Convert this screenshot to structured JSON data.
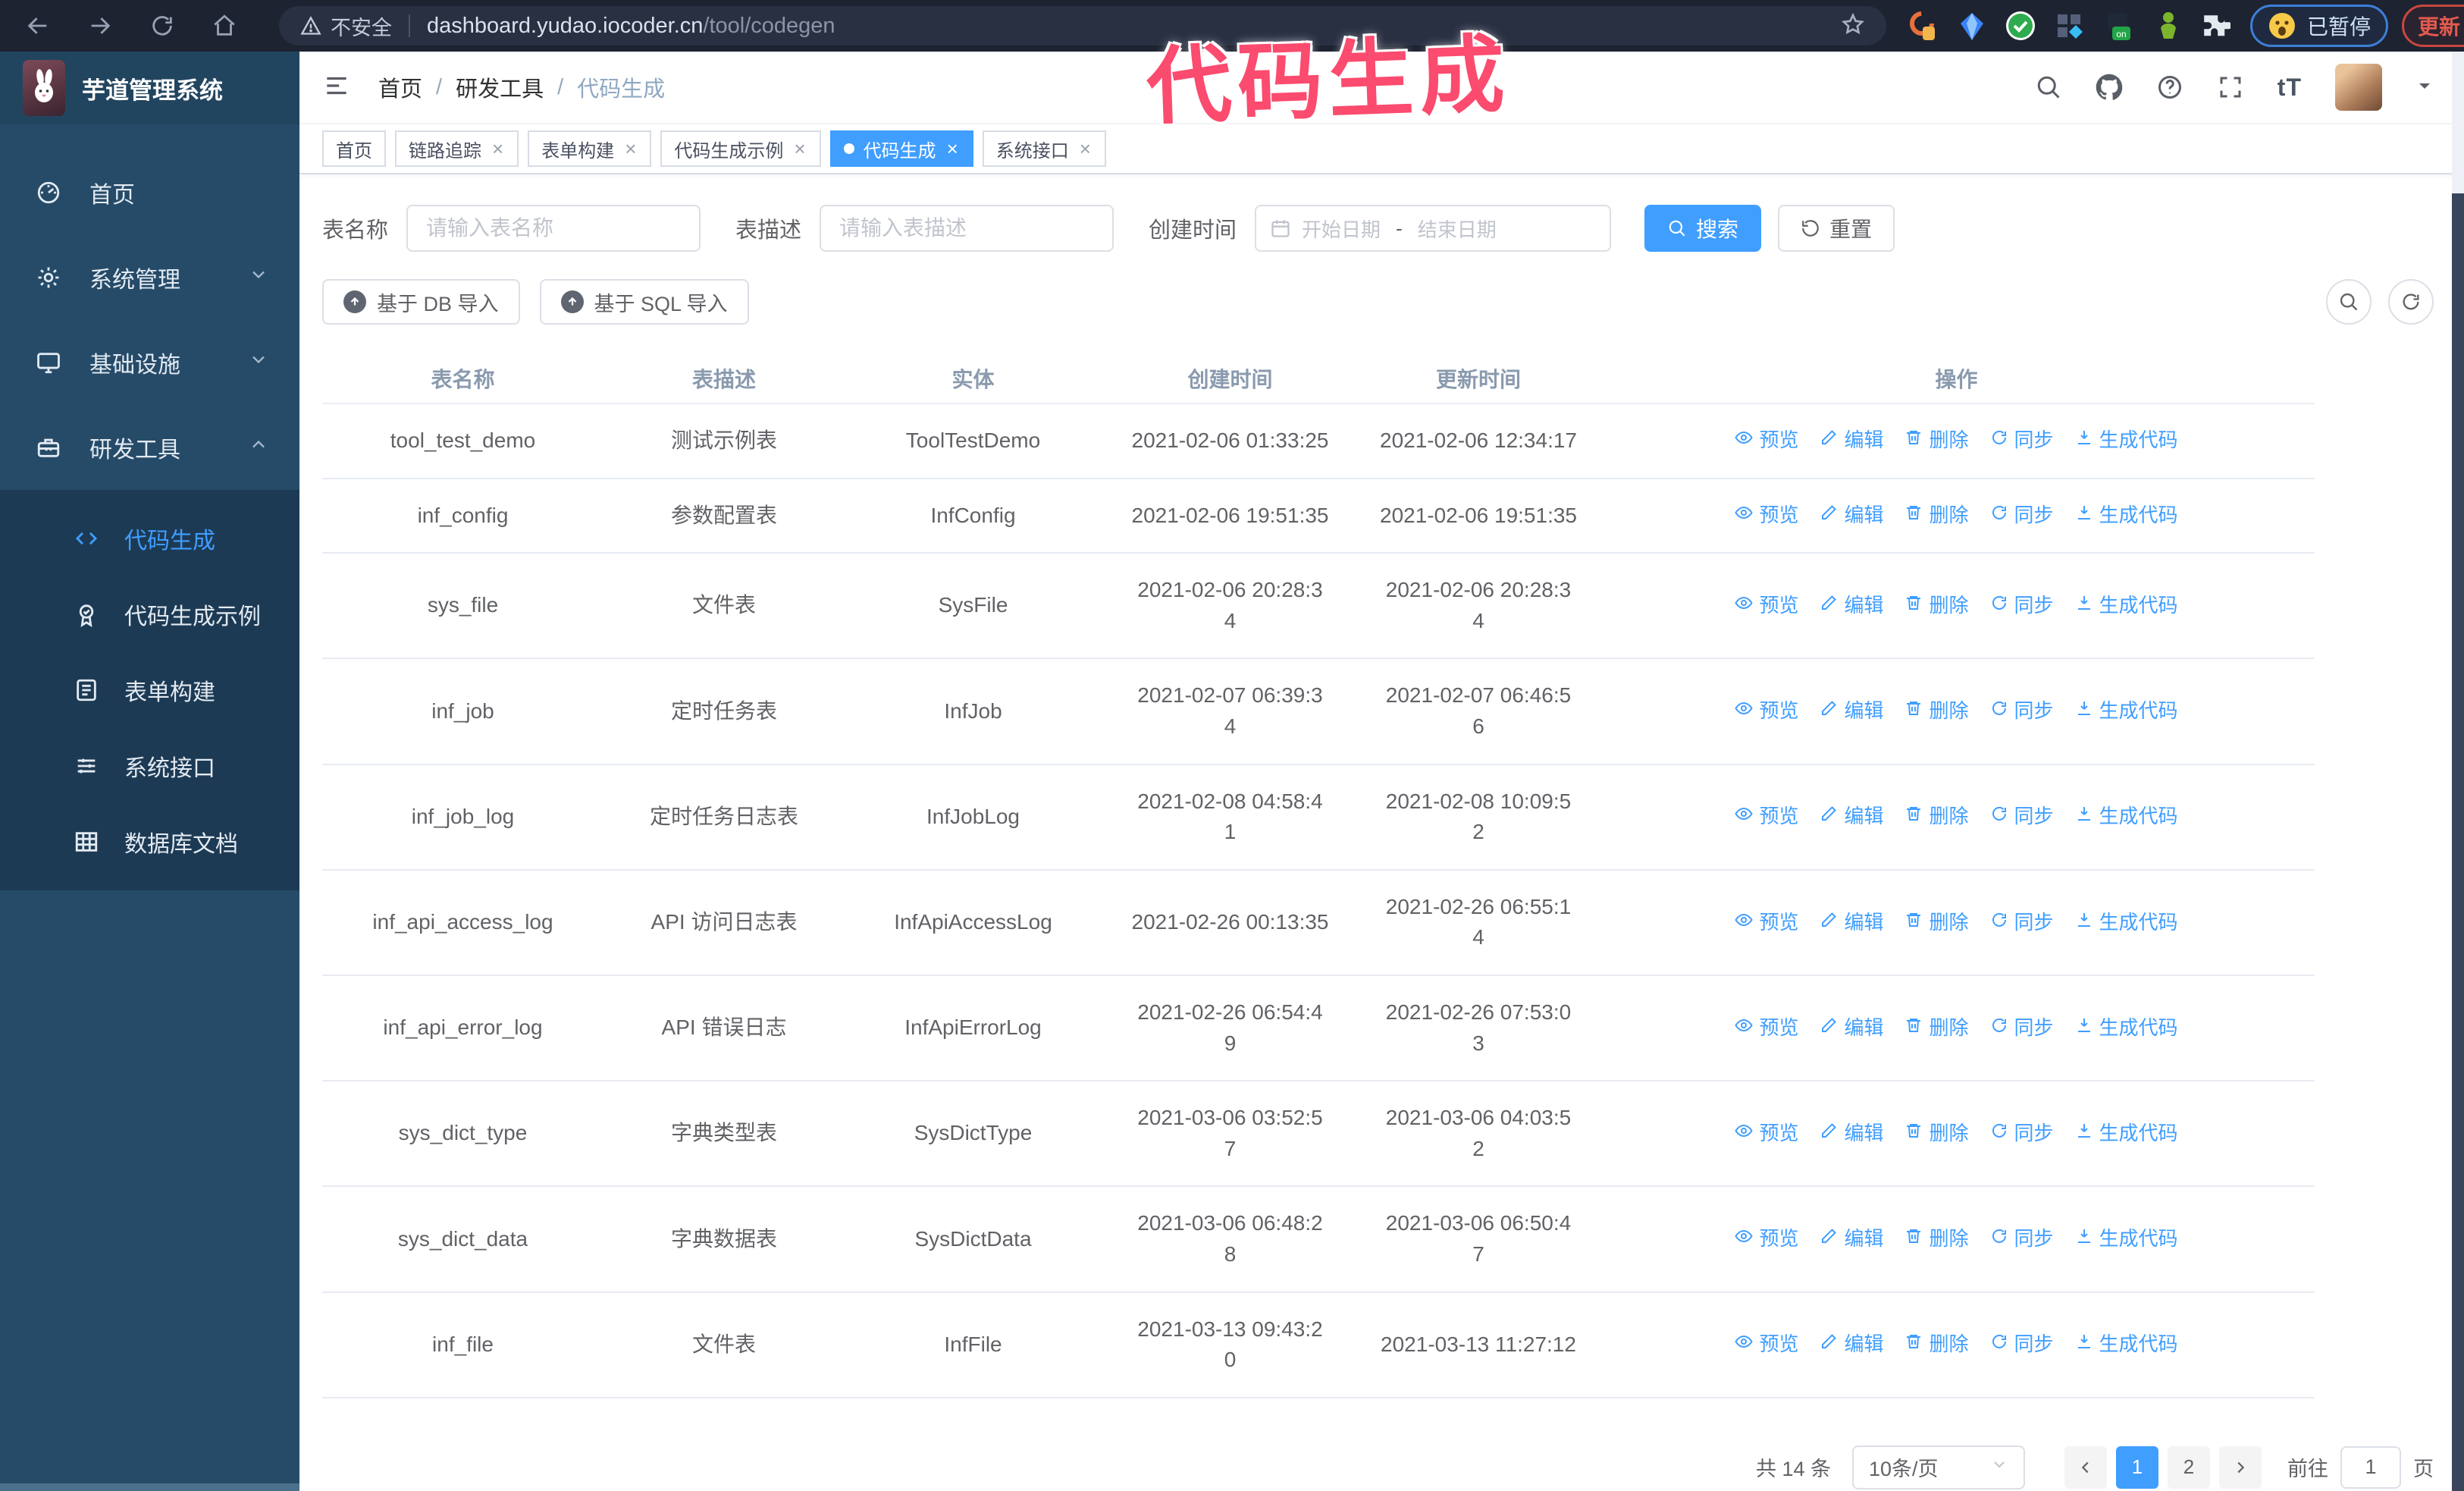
{
  "browser": {
    "security_warning": "不安全",
    "url_host": "dashboard.yudao.iocoder.cn",
    "url_path": "/tool/codegen",
    "paused_badge": "已暂停",
    "update_button": "更新"
  },
  "annotation": {
    "text": "代码生成",
    "color": "#fb4b6e"
  },
  "header": {
    "logo_title": "芋道管理系统",
    "breadcrumb": [
      "首页",
      "研发工具",
      "代码生成"
    ]
  },
  "sidebar": {
    "items": [
      {
        "label": "首页",
        "icon": "dashboard-icon",
        "expandable": false,
        "expanded": false,
        "active": false
      },
      {
        "label": "系统管理",
        "icon": "gear-icon",
        "expandable": true,
        "expanded": false,
        "active": false
      },
      {
        "label": "基础设施",
        "icon": "monitor-icon",
        "expandable": true,
        "expanded": false,
        "active": false
      },
      {
        "label": "研发工具",
        "icon": "toolbox-icon",
        "expandable": true,
        "expanded": true,
        "active": false
      }
    ],
    "submenu": [
      {
        "label": "代码生成",
        "icon": "code-icon",
        "active": true
      },
      {
        "label": "代码生成示例",
        "icon": "example-icon",
        "active": false
      },
      {
        "label": "表单构建",
        "icon": "form-icon",
        "active": false
      },
      {
        "label": "系统接口",
        "icon": "sliders-icon",
        "active": false
      },
      {
        "label": "数据库文档",
        "icon": "db-table-icon",
        "active": false
      }
    ]
  },
  "tabs": [
    {
      "label": "首页",
      "closable": false,
      "active": false
    },
    {
      "label": "链路追踪",
      "closable": true,
      "active": false
    },
    {
      "label": "表单构建",
      "closable": true,
      "active": false
    },
    {
      "label": "代码生成示例",
      "closable": true,
      "active": false
    },
    {
      "label": "代码生成",
      "closable": true,
      "active": true
    },
    {
      "label": "系统接口",
      "closable": true,
      "active": false
    }
  ],
  "filters": {
    "table_name_label": "表名称",
    "table_name_placeholder": "请输入表名称",
    "table_desc_label": "表描述",
    "table_desc_placeholder": "请输入表描述",
    "create_time_label": "创建时间",
    "date_start_placeholder": "开始日期",
    "date_separator": "-",
    "date_end_placeholder": "结束日期",
    "search_button": "搜索",
    "reset_button": "重置"
  },
  "toolbar": {
    "import_db_button": "基于 DB 导入",
    "import_sql_button": "基于 SQL 导入"
  },
  "table": {
    "columns": [
      "表名称",
      "表描述",
      "实体",
      "创建时间",
      "更新时间",
      "操作"
    ],
    "actions": [
      {
        "label": "预览",
        "icon": "eye-icon"
      },
      {
        "label": "编辑",
        "icon": "edit-icon"
      },
      {
        "label": "删除",
        "icon": "delete-icon"
      },
      {
        "label": "同步",
        "icon": "sync-icon"
      },
      {
        "label": "生成代码",
        "icon": "download-icon"
      }
    ],
    "rows": [
      {
        "name": "tool_test_demo",
        "desc": "测试示例表",
        "entity": "ToolTestDemo",
        "created": "2021-02-06 01:33:25",
        "updated": "2021-02-06 12:34:17",
        "wrap_created": false,
        "wrap_updated": false
      },
      {
        "name": "inf_config",
        "desc": "参数配置表",
        "entity": "InfConfig",
        "created": "2021-02-06 19:51:35",
        "updated": "2021-02-06 19:51:35",
        "wrap_created": false,
        "wrap_updated": false
      },
      {
        "name": "sys_file",
        "desc": "文件表",
        "entity": "SysFile",
        "created": "2021-02-06 20:28:34",
        "updated": "2021-02-06 20:28:34",
        "wrap_created": true,
        "wrap_updated": true
      },
      {
        "name": "inf_job",
        "desc": "定时任务表",
        "entity": "InfJob",
        "created": "2021-02-07 06:39:34",
        "updated": "2021-02-07 06:46:56",
        "wrap_created": true,
        "wrap_updated": true
      },
      {
        "name": "inf_job_log",
        "desc": "定时任务日志表",
        "entity": "InfJobLog",
        "created": "2021-02-08 04:58:41",
        "updated": "2021-02-08 10:09:52",
        "wrap_created": true,
        "wrap_updated": true
      },
      {
        "name": "inf_api_access_log",
        "desc": "API 访问日志表",
        "entity": "InfApiAccessLog",
        "created": "2021-02-26 00:13:35",
        "updated": "2021-02-26 06:55:14",
        "wrap_created": false,
        "wrap_updated": true
      },
      {
        "name": "inf_api_error_log",
        "desc": "API 错误日志",
        "entity": "InfApiErrorLog",
        "created": "2021-02-26 06:54:49",
        "updated": "2021-02-26 07:53:03",
        "wrap_created": true,
        "wrap_updated": true
      },
      {
        "name": "sys_dict_type",
        "desc": "字典类型表",
        "entity": "SysDictType",
        "created": "2021-03-06 03:52:57",
        "updated": "2021-03-06 04:03:52",
        "wrap_created": true,
        "wrap_updated": true
      },
      {
        "name": "sys_dict_data",
        "desc": "字典数据表",
        "entity": "SysDictData",
        "created": "2021-03-06 06:48:28",
        "updated": "2021-03-06 06:50:47",
        "wrap_created": true,
        "wrap_updated": true
      },
      {
        "name": "inf_file",
        "desc": "文件表",
        "entity": "InfFile",
        "created": "2021-03-13 09:43:20",
        "updated": "2021-03-13 11:27:12",
        "wrap_created": true,
        "wrap_updated": false
      }
    ]
  },
  "pagination": {
    "total_text": "共 14 条",
    "page_size": "10条/页",
    "pages": [
      "1",
      "2"
    ],
    "active_page": "1",
    "goto_label": "前往",
    "goto_value": "1",
    "page_unit": "页"
  },
  "colors": {
    "accent": "#409eff",
    "sidebar_bg": "#264b68",
    "submenu_bg": "#1d3a54",
    "annotation_pink": "#fb4b6e",
    "update_red": "#e25a4e",
    "paused_blue": "#3d7fd8"
  }
}
